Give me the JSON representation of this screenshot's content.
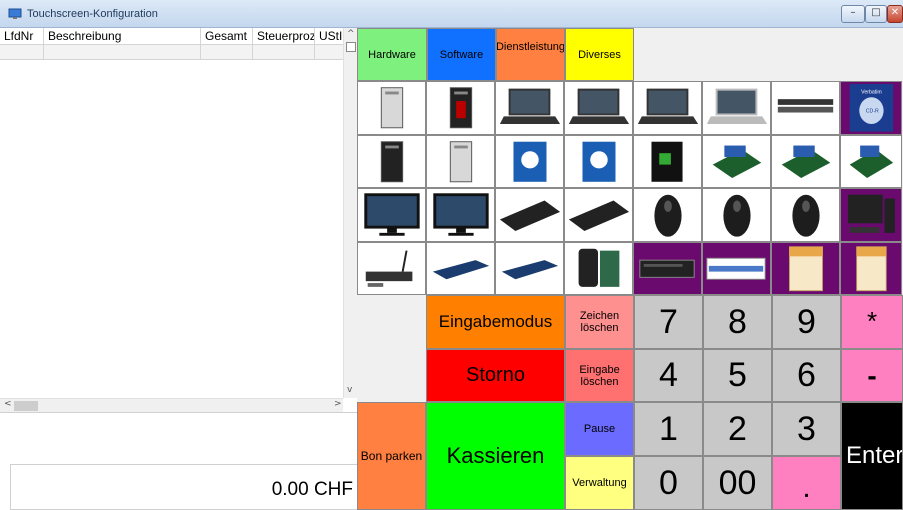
{
  "window": {
    "title": "Touchscreen-Konfiguration",
    "controls": [
      "–",
      "□",
      "✕"
    ]
  },
  "grid": {
    "columns": [
      "LfdNr",
      "Beschreibung",
      "Gesamt",
      "Steuerprozent",
      "UStID"
    ],
    "rows": []
  },
  "total": {
    "value": "0.00 CHF"
  },
  "categories": [
    {
      "label": "Hardware",
      "color": "#7ef07e"
    },
    {
      "label": "Software",
      "color": "#1070ff"
    },
    {
      "label": "Dienstleistung",
      "color": "#ff8040"
    },
    {
      "label": "Diverses",
      "color": "#ffff00"
    }
  ],
  "products": [
    [
      "tower-pc-white",
      "tower-pc-black-red",
      "laptop-dark",
      "laptop-black",
      "laptop-black-2",
      "laptop-silver",
      "rack-server",
      "verbatim-cd-spindle"
    ],
    [
      "tower-pc-black",
      "tower-pc-silver",
      "intel-cpu-box",
      "intel-cpu-box-2",
      "amd-cpu-box",
      "motherboard",
      "motherboard-2",
      "motherboard-3"
    ],
    [
      "monitor-black",
      "monitor-black-2",
      "ergonomic-keyboard",
      "keyboard",
      "mouse-logitech",
      "mouse-black",
      "mouse-gaming",
      "desktop-set"
    ],
    [
      "wifi-router",
      "network-switch",
      "network-switch-2",
      "bag-camera",
      "dvd-drive",
      "network-card",
      "software-box",
      "software-box-2"
    ]
  ],
  "brand_labels": {
    "cd_spindle": "Verbatim",
    "cd_label": "CD-R"
  },
  "actions": {
    "eingabemodus": "Eingabemodus",
    "storno": "Storno",
    "zeichen_loeschen": "Zeichen löschen",
    "eingabe_loeschen": "Eingabe löschen",
    "bon_parken": "Bon parken",
    "kassieren": "Kassieren",
    "pause": "Pause",
    "verwaltung": "Verwaltung",
    "enter": "Enter",
    "multiply": "*",
    "minus": "-",
    "decimal": "."
  },
  "keypad": [
    "7",
    "8",
    "9",
    "4",
    "5",
    "6",
    "1",
    "2",
    "3",
    "0",
    "00"
  ],
  "colors": {
    "eingabemodus": "#ff8000",
    "storno": "#ff0000",
    "kassieren": "#00ff00",
    "bon_parken": "#ff8040",
    "zeichen_loeschen": "#ff9090",
    "eingabe_loeschen": "#ff7070",
    "pause": "#6b6bff",
    "verwaltung": "#ffff80",
    "operator_pink": "#ff80c0",
    "keypad_gray": "#c8c8c8",
    "enter": "#000000"
  }
}
